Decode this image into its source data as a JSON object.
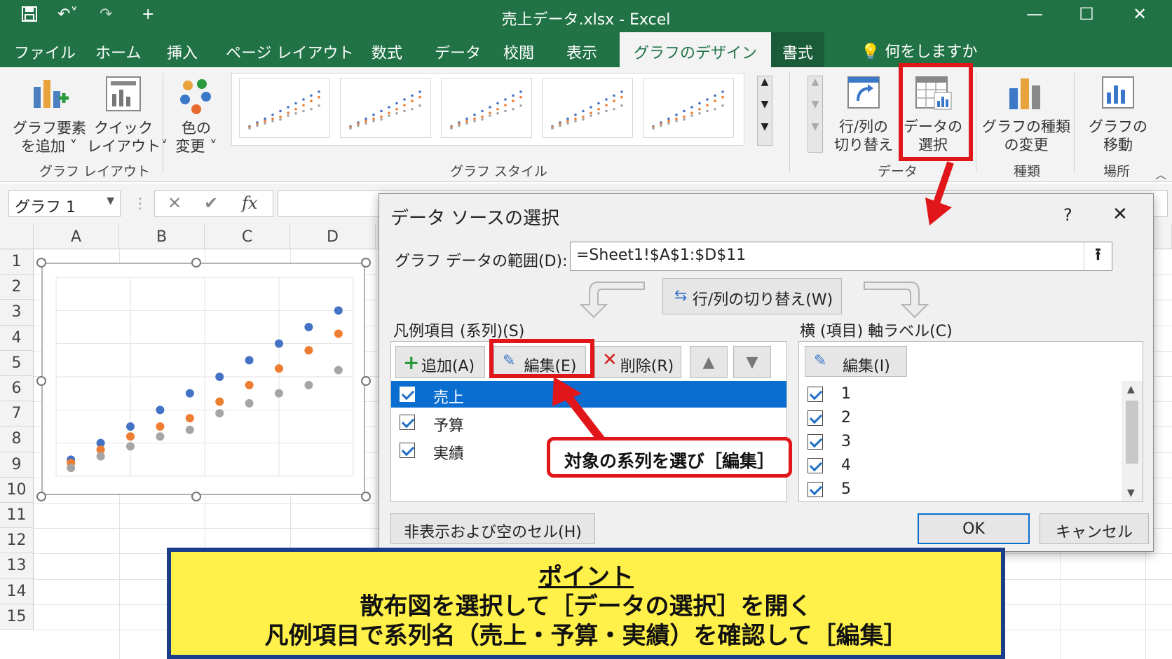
{
  "titlebar": {
    "title": "売上データ.xlsx  -  Excel",
    "icons": [
      "save-icon",
      "undo-icon",
      "redo-icon",
      "new-icon"
    ],
    "window_controls": [
      "minimize-icon",
      "maximize-icon",
      "close-icon"
    ]
  },
  "tabs": {
    "items": [
      "ファイル",
      "ホーム",
      "挿入",
      "ページ レイアウト",
      "数式",
      "データ",
      "校閲",
      "表示",
      "グラフのデザイン",
      "書式"
    ],
    "active": "グラフのデザイン",
    "tell_me": "何をしますか"
  },
  "ribbon": {
    "add_element": "グラフ要素\nを追加 ˅",
    "quick_layout": "クイック\nレイアウト˅",
    "change_color": "色の\n変更 ˅",
    "switch_row_col": "行/列の\n切り替え",
    "select_data": "データの\n選択",
    "change_type": "グラフの種類\nの変更",
    "move_chart": "グラフの\n移動",
    "groups": {
      "layout": "グラフ レイアウト",
      "styles": "グラフ スタイル",
      "data": "データ",
      "type": "種類",
      "location": "場所"
    }
  },
  "formula_bar": {
    "name_box": "グラフ 1",
    "fx": "fx"
  },
  "sheet": {
    "columns": [
      "A",
      "B",
      "C",
      "D"
    ],
    "rows": [
      "1",
      "2",
      "3",
      "4",
      "5",
      "6",
      "7",
      "8",
      "9",
      "10",
      "11",
      "12",
      "13",
      "14",
      "15"
    ]
  },
  "chart_data": {
    "type": "scatter",
    "series": [
      {
        "name": "売上",
        "color": "#4472c4",
        "values": [
          1,
          2,
          3,
          4,
          5,
          6,
          7,
          8,
          9,
          10
        ]
      },
      {
        "name": "予算",
        "color": "#ed7d31",
        "values": [
          0.8,
          1.6,
          2.4,
          3,
          3.5,
          4.5,
          5.5,
          6.5,
          7.6,
          8.6
        ]
      },
      {
        "name": "実績",
        "color": "#a5a5a5",
        "values": [
          0.5,
          1.2,
          1.8,
          2.4,
          2.8,
          3.8,
          4.4,
          5,
          5.5,
          6.4
        ]
      }
    ],
    "x": [
      1,
      2,
      3,
      4,
      5,
      6,
      7,
      8,
      9,
      10
    ],
    "ylim": [
      0,
      12
    ],
    "grid": true
  },
  "dialog": {
    "title": "データ ソースの選択",
    "help": "?",
    "close": "✕",
    "range_label": "グラフ データの範囲(D):",
    "range_value": "=Sheet1!$A$1:$D$11",
    "switch_button": "行/列の切り替え(W)",
    "legend_label": "凡例項目 (系列)(S)",
    "axis_label": "横 (項目) 軸ラベル(C)",
    "add_button": "追加(A)",
    "edit_button": "編集(E)",
    "delete_button": "削除(R)",
    "axis_edit_button": "編集(I)",
    "series": [
      "売上",
      "予算",
      "実績"
    ],
    "axis_items": [
      "1",
      "2",
      "3",
      "4",
      "5"
    ],
    "hidden_cells_button": "非表示および空のセル(H)",
    "ok_button": "OK",
    "cancel_button": "キャンセル"
  },
  "annotations": {
    "callout": "対象の系列を選び［編集］",
    "banner_title": "ポイント",
    "banner_line1": "散布図を選択して［データの選択］を開く",
    "banner_line2": "凡例項目で系列名（売上・予算・実績）を確認して［編集］",
    "accent": "#e0161a"
  }
}
